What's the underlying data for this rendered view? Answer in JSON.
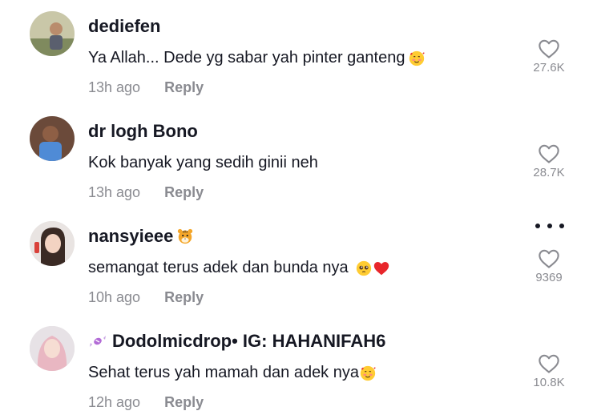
{
  "comments": [
    {
      "username": "dediefen",
      "text": "Ya Allah... Dede yg sabar yah pinter ganteng",
      "text_emoji": "smiling-face-with-hearts-icon",
      "time": "13h ago",
      "reply_label": "Reply",
      "likes": "27.6K"
    },
    {
      "username": "dr logh Bono",
      "text": "Kok banyak yang sedih ginii neh",
      "time": "13h ago",
      "reply_label": "Reply",
      "likes": "28.7K"
    },
    {
      "username": "nansyieee",
      "username_emoji": "tiger-face-icon",
      "text": "semangat terus adek dan bunda nya",
      "text_emoji": "pleading-face-and-red-heart-icons",
      "time": "10h ago",
      "reply_label": "Reply",
      "likes": "9369"
    },
    {
      "username": "Dodolmicdrop• IG: HAHANIFAH6",
      "username_prefix_icon": "candy-icon",
      "text": "Sehat terus yah mamah dan adek nya",
      "text_emoji": "smiling-face-with-hearts-icon",
      "time": "12h ago",
      "reply_label": "Reply",
      "likes": "10.8K"
    }
  ],
  "more_menu_icon": "more-horizontal-icon",
  "like_icon": "heart-outline-icon",
  "colors": {
    "text_primary": "#161823",
    "text_secondary": "#8a8b91",
    "background": "#ffffff"
  }
}
